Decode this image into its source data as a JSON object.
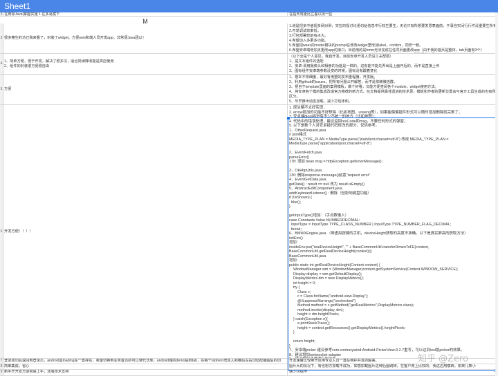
{
  "sheet": {
    "title": "Sheet1"
  },
  "center_label": "M",
  "rows": [
    {
      "num": "2",
      "left": "在商标Java|掌握实施 1 在多易案下",
      "right": "在拍天将更比立差以找一些"
    },
    {
      "num": "3",
      "left": "很多擦生的功已我来看了，封装了widget。方便web和端人员开发app，非常便Java团以！",
      "right": "1.增是把多中值视多网对例，实在的视讨论语句给信息中行较生要生，无论只有所想要发思表面前，于事自实间行行件没重要生所有\n2.开发调试效率低。\n3.打包部署较前有点大。\n4.希望加入多更多功能。\n5.希望把weex的model模块的prompt在修改widget里增加label，confirm，同样一致。\n6.希望安卓端增加支更改app的接口，目前用的是hmm无法完成在任同页面更改app（由于我的首页是整体，tab页面有3个）\n7.希望将weex平端口问题（同下任何无法判断），只能统一加上端口或者不加，导致同我在网与URL的对域含拼接错误。\n8.希望整批一批以外能源，期跨完表了。\n9.github上整个二维码，理打算对coffee都不行。唉~~~~"
    },
    {
      "num": "4",
      "left": "1、简单方便，便于开发，解决了很多坑，适合简读降收能是类店使用\n2、组件的封装很方便很自由",
      "right": "（以下全是个人意见，我自开发，目前安卓开发人员没工夫帮助）\n1、提文本组件的选配\n2、安卓·调用摄像头和相册的功能是一样的，进有能不能先弄出是上面开后的，而不是直接上传\n3、图标组件安卓端参数没变的时候，图标没有跟着变化"
    },
    {
      "num": "5",
      "left": "方便",
      "right": "1、根本不将细度，最好有用塑的发布重程摘，开发版。\n2、利用github的issues，把所有问题公开解答，而不是依赖微信群。\n3、把自于template里面的案例模板，做个好看，又能方便查阅各个module，widget使用方法。\n4、将安卓各个模的集成改造官方推荐的新方式，在文档提供最佳遗进的技术思，模板和作者的更新位置会与官方工具生成的也有所区分。\n5、尽早推出动态加载，减少打包体积。\n6、自新更多发灯泡、大灯泡。"
    },
    {
      "num": "6",
      "left": "开发方便！！！！",
      "right": "1. 原生略不太好实现；\n2. errow提加的功能不好移除（比如地图，urweng等），如果能偏偏插件形式可以随时增加删除就完美了；\n3. 安卓端8lool插进有不少不统一的地方（比如地图）；\n4. 代码中的错误处理，建议返回resCode和msg，不要任何形式的弹窗；\n5. 以下是数个人对安卓插代码修改的部分，仅供参考。\n1、OtherRequest.java\n// json格式\nMEDIA_TYPE_PLAN = MediaType.parse(\"plain/text;charset=utf-8\") 改成 MEDIA_TYPE_PLAN = MediaType.parse(\"application/json;charset=utf-8\")\n\n2、EventFetch.java\nparseError()\n178: 增加 bean.msg = httpException.getInnerMessage();\n\n3、OkHttpUtils.java\n130: 删除response.message()前置\"request error\"\n4、EventGetData.java\ngetData() : result == null 改为 result.isEmpty()\n5、AbstractEditComponent.java\naddKeyboardListener() : 删除（但影响键盘功能）\nif (!isShown) {\n  blur();\n}\n\ngetInputType()增加：（手点数输入）\ncase Constants.Value.NUMBERDECIMAL:\n  inputType = InputType.TYPE_CLASS_NUMBER | InputType.TYPE_NUMBER_FLAG_DECIMAL;\n  break;\n6、BMWXEngine.java （带虚拟按键的手机，deviceHeight获取的高度不准确，以下是真实屏高的获取方法）\ninitEnv()\n增加:\ninsideEnv.put(\"realDeviceHeight\", \"\" + BaseCommonUtil.transferDimenToFE(context, BaseCommonUtil.getRealDeviceHeight(context)));\nBaseCommonUtil.java\n增加:\npublic static int getRealDeviceHeight(Context context) {\n    WindowManager wm = (WindowManager)context.getSystemService(Context.WINDOW_SERVICE);\n    Display display = wm.getDefaultDisplay();\n    DisplayMetrics dm = new DisplayMetrics();\n    int height = 0;\n    try {\n        Class c;\n        c = Class.forName(\"android.view.Display\");\n        @SuppressWarnings(\"unchecked\")\n        Method method = c.getMethod(\"getRealMetrics\",DisplayMetrics.class);\n        method.invoke(display, dm);\n        height = dm.heightPixels;\n    } catch(Exception e){\n        e.printStackTrace();\n        height = context.getResources().getDisplayMetrics().heightPixels;\n    }\n\n    return height;\n}\n7、安卓端picker 建议参考com.contrarywind:Android-PickerView:3.2.7重写，可以达到iosl版picker的效果。\n8、建议增加websocket adapter\n9、建议增加清缓缓存的功能"
    },
    {
      "num": "7",
      "left": "登录成功后返回到登录页，android返loading在一直存在，希望切换到业务首页的可以使代法库，android端的demo提到tab，在每个tabItem增加入和推后左右切动配播图后的切tabItem。",
      "right": "开发速度比较带开应用专业入员一直在维护并发的解答。"
    },
    {
      "num": "8",
      "left": "简单集成，省心",
      "right": "图片大的情况下，有也想方加载不成功，如感加载图片这种后图跳转，在客户用上比较的，我这边用模转。如果几乘小"
    },
    {
      "num": "9",
      "left": "新手开开发方便容易上手，还有技术支持",
      "right": "缺少UI组件"
    }
  ],
  "watermark": "知乎 @Zero"
}
